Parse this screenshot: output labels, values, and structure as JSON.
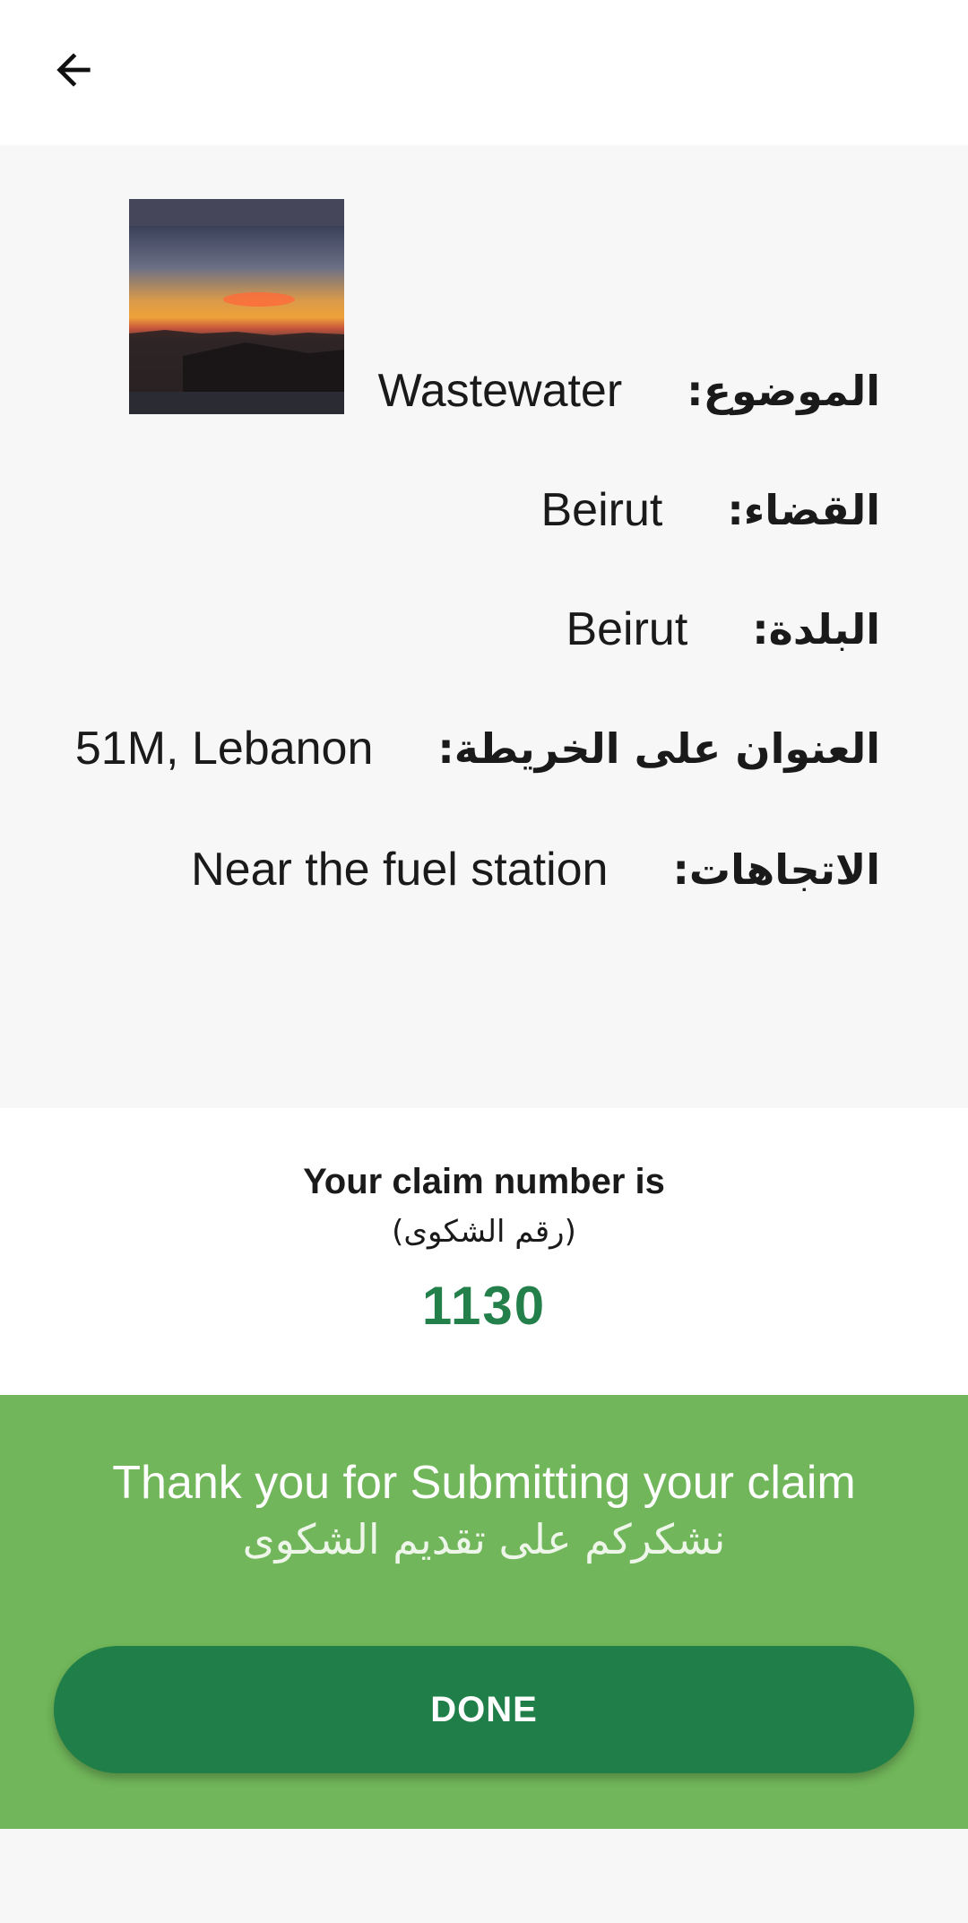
{
  "app_bar": {
    "back_icon": "arrow-back-icon"
  },
  "details": {
    "photo": {
      "description_icon": "sunset-photo"
    },
    "rows": [
      {
        "label": "الموضوع:",
        "value": "Wastewater"
      },
      {
        "label": "القضاء:",
        "value": "Beirut"
      },
      {
        "label": "البلدة:",
        "value": "Beirut"
      },
      {
        "label": "العنوان على الخريطة:",
        "value": "51M, Lebanon"
      },
      {
        "label": "الاتجاهات:",
        "value": "Near the fuel station"
      }
    ]
  },
  "claim": {
    "title": "Your claim number is",
    "subtitle": "(رقم الشكوى)",
    "number": "1130"
  },
  "thanks": {
    "english": "Thank you for Submitting your claim",
    "arabic": "نشكركم على تقديم الشكوى",
    "done_label": "DONE"
  },
  "colors": {
    "accent_green": "#23804a",
    "banner_green": "#71b65a",
    "button_green": "#207f48"
  }
}
